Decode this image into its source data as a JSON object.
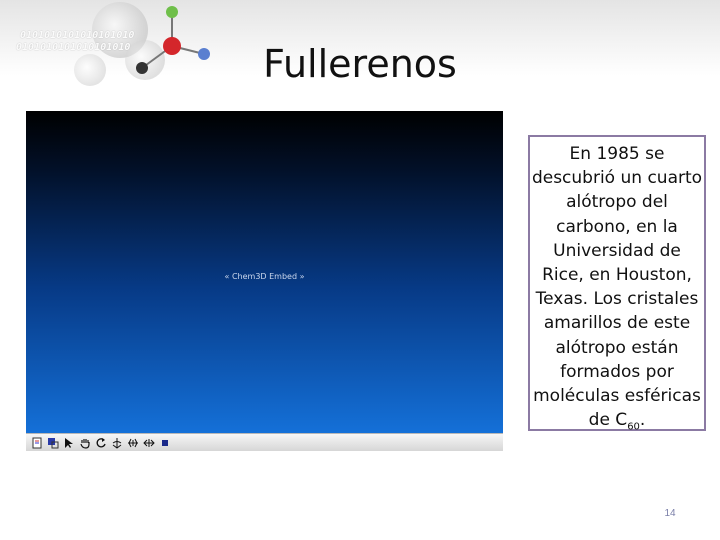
{
  "slide": {
    "title": "Fullerenos",
    "page_number": "14",
    "decoration": {
      "binary_line_1": "0101010101010101010",
      "binary_line_2": "0101010101010101010",
      "icon": "molecule-model-icon"
    }
  },
  "embed": {
    "label": "« Chem3D Embed »",
    "toolbar_icons": [
      "page-icon",
      "select-icon",
      "pointer-arrow-icon",
      "hand-icon",
      "rotate-icon",
      "rotate-x-icon",
      "rotate-y-icon",
      "rotate-z-icon",
      "stop-icon"
    ]
  },
  "textbox": {
    "text_before_formula": "En 1985 se descubrió un cuarto alótropo del carbono, en la Universidad de Rice, en Houston, Texas. Los cristales amarillos de este alótropo están formados por moléculas esféricas de C",
    "formula_subscript": "60",
    "text_after_formula": "."
  },
  "colors": {
    "embed_gradient_top": "#000000",
    "embed_gradient_bottom": "#1470d8",
    "textbox_border": "#8b7aa3",
    "page_number": "#7a7fa8"
  }
}
